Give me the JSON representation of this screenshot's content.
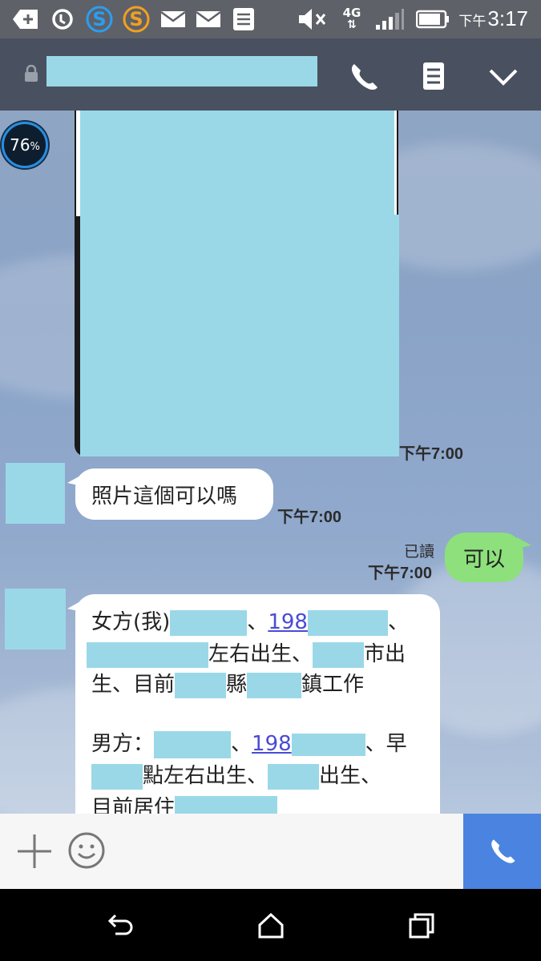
{
  "status_bar": {
    "time_prefix": "下午",
    "time": "3:17",
    "network": "4G",
    "icons": [
      "add-icon",
      "sync-icon",
      "s-app-blue-icon",
      "s-app-orange-icon",
      "mail-icon",
      "mail-icon",
      "note-icon",
      "mute-icon",
      "signal-icon",
      "battery-icon"
    ]
  },
  "header": {
    "icons": [
      "lock-icon",
      "phone-icon",
      "menu-icon",
      "chevron-down-icon"
    ]
  },
  "overlay": {
    "battery_badge_value": "76",
    "battery_badge_unit": "%"
  },
  "messages": [
    {
      "type": "photo",
      "direction": "in",
      "time": "下午7:00"
    },
    {
      "type": "text",
      "direction": "in",
      "text": "照片這個可以嗎",
      "time": "下午7:00"
    },
    {
      "type": "text",
      "direction": "out",
      "text": "可以",
      "read": "已讀",
      "time": "下午7:00"
    },
    {
      "type": "text",
      "direction": "in",
      "lines": {
        "l1a": "女方(我)",
        "l1b": "、",
        "l1link": "198",
        "l1c": "、",
        "l2a": "左右出生、",
        "l2b": "市出",
        "l3a": "生、目前",
        "l3b": "縣",
        "l3c": "鎮工作",
        "l4a": "男方：",
        "l4b": "、",
        "l4link": "198",
        "l4c": "、早",
        "l5a": "點左右出生、",
        "l5b": "出生、",
        "l6a": "目前居住"
      }
    }
  ],
  "input_bar": {
    "icons": [
      "plus-icon",
      "emoji-icon",
      "phone-icon"
    ],
    "accent_color": "#4a84e0"
  },
  "nav_bar": {
    "icons": [
      "back-icon",
      "home-icon",
      "recents-icon"
    ]
  },
  "colors": {
    "redaction": "#9ad8e8",
    "bubble_out": "#8de07b",
    "bubble_in": "#ffffff",
    "link": "#4a4ad6"
  }
}
